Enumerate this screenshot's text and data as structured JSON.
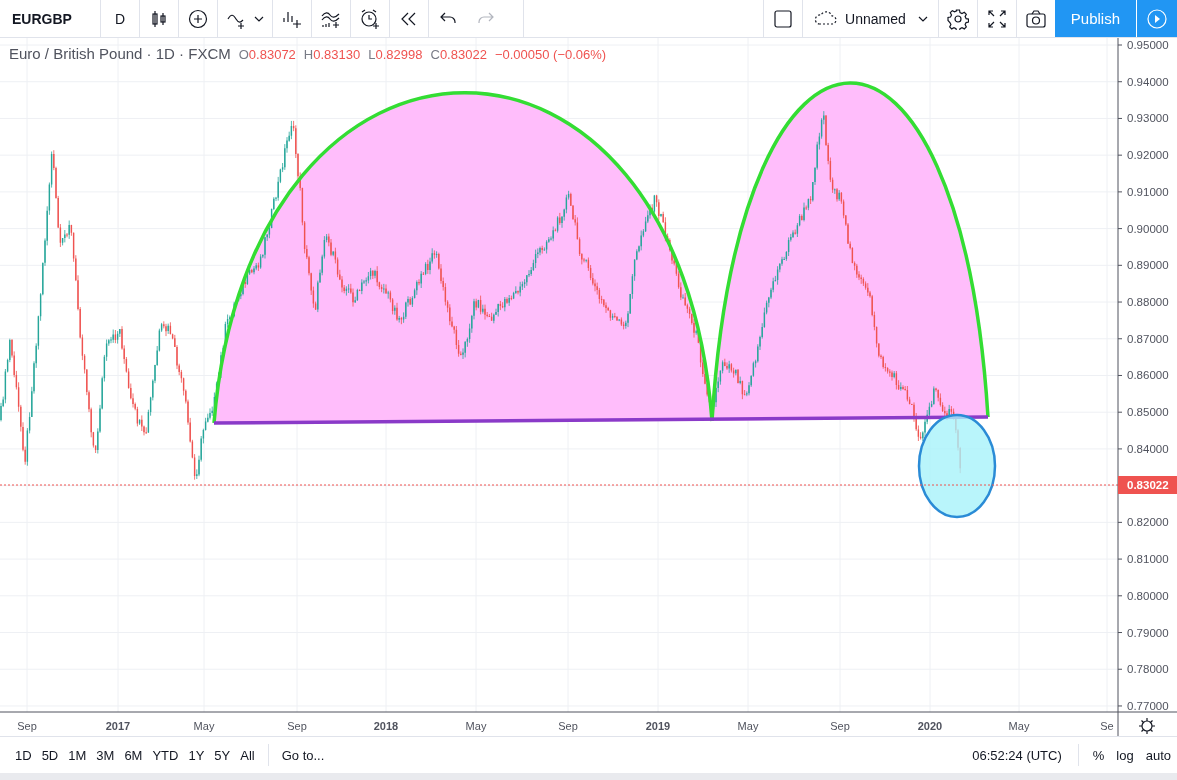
{
  "toolbar": {
    "symbol": "EURGBP",
    "interval": "D",
    "layout_name": "Unnamed",
    "publish": "Publish",
    "redo_disabled": true
  },
  "legend": {
    "title": "Euro / British Pound · 1D · FXCM",
    "fields": [
      {
        "label": "O",
        "value": "0.83072"
      },
      {
        "label": "H",
        "value": "0.83130"
      },
      {
        "label": "L",
        "value": "0.82998"
      },
      {
        "label": "C",
        "value": "0.83022"
      }
    ],
    "change": "−0.00050 (−0.06%)"
  },
  "price_axis": {
    "labels": [
      "0.95000",
      "0.94000",
      "0.93000",
      "0.92000",
      "0.91000",
      "0.90000",
      "0.89000",
      "0.88000",
      "0.87000",
      "0.86000",
      "0.85000",
      "0.84000",
      "0.82000",
      "0.81000",
      "0.80000",
      "0.79000",
      "0.78000",
      "0.77000"
    ],
    "last_price": "0.83022"
  },
  "time_axis": {
    "labels": [
      "Sep",
      "2017",
      "May",
      "Sep",
      "2018",
      "May",
      "Sep",
      "2019",
      "May",
      "Sep",
      "2020",
      "May",
      "Se"
    ]
  },
  "bottom_bar": {
    "ranges": [
      "1D",
      "5D",
      "1M",
      "3M",
      "6M",
      "YTD",
      "1Y",
      "5Y",
      "All"
    ],
    "goto": "Go to...",
    "clock": "06:52:24 (UTC)",
    "options": [
      "%",
      "log",
      "auto"
    ]
  }
}
